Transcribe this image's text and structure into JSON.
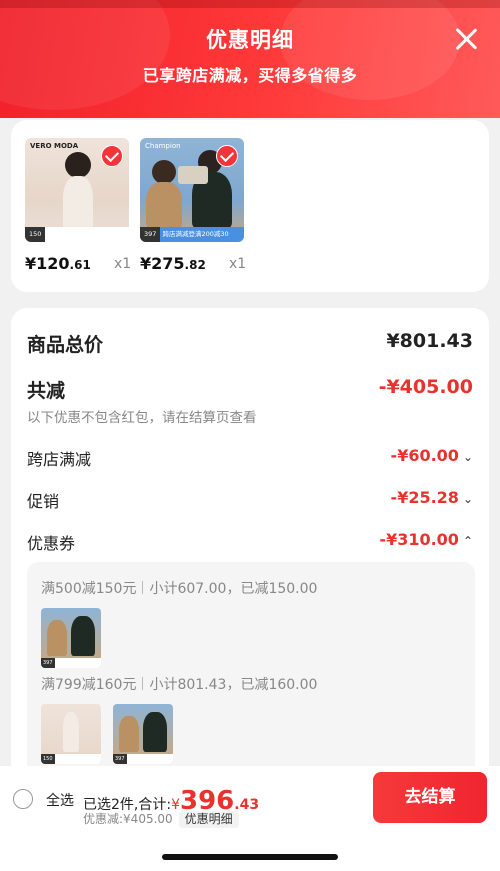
{
  "header": {
    "title": "优惠明细",
    "subtitle": "已享跨店满减，买得多省得多"
  },
  "products": [
    {
      "brand": "VERO MODA",
      "price_int": "¥120",
      "price_dec": ".61",
      "qty": "x1",
      "badge_num": "150",
      "checked": true
    },
    {
      "brand": "Champion",
      "price_int": "¥275",
      "price_dec": ".82",
      "qty": "x1",
      "badge_num": "397",
      "promo_text": "跨店满减登满200减30",
      "checked": true
    }
  ],
  "breakdown": {
    "total_label": "商品总价",
    "total_value": "¥801.43",
    "reduce_label": "共减",
    "reduce_value": "-¥405.00",
    "note": "以下优惠不包含红包，请在结算页查看",
    "items": [
      {
        "label": "跨店满减",
        "value": "-¥60.00",
        "chevron": "chevron-down-icon"
      },
      {
        "label": "促销",
        "value": "-¥25.28",
        "chevron": "chevron-down-icon"
      },
      {
        "label": "优惠券",
        "value": "-¥310.00",
        "chevron": "chevron-up-icon"
      }
    ],
    "coupons": [
      {
        "rule": "满500减150元",
        "summary": "小计607.00，已减150.00"
      },
      {
        "rule": "满799减160元",
        "summary": "小计801.43，已减160.00"
      }
    ]
  },
  "footer": {
    "select_all": "全选",
    "selected_text": "已选2件,合计:",
    "total_currency": "¥",
    "total_int": "396",
    "total_dec": ".43",
    "discount_text": "优惠减:¥405.00",
    "detail_label": "优惠明细",
    "checkout_label": "去结算"
  },
  "colors": {
    "accent_red": "#e8322e",
    "header_red": "#f0202a"
  }
}
